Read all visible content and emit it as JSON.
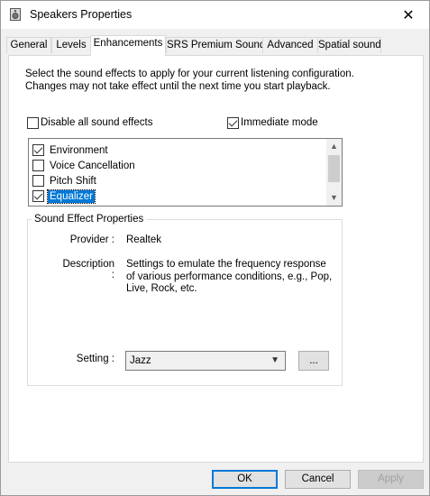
{
  "window": {
    "title": "Speakers Properties"
  },
  "tabs": [
    {
      "label": "General"
    },
    {
      "label": "Levels"
    },
    {
      "label": "Enhancements",
      "active": true
    },
    {
      "label": "SRS Premium Sound"
    },
    {
      "label": "Advanced"
    },
    {
      "label": "Spatial sound"
    }
  ],
  "enhancements": {
    "description": "Select the sound effects to apply for your current listening configuration. Changes may not take effect until the next time you start playback.",
    "disable_all": {
      "label": "Disable all sound effects",
      "checked": false
    },
    "immediate_mode": {
      "label": "Immediate mode",
      "checked": true
    },
    "effects": [
      {
        "label": "Environment",
        "checked": true,
        "selected": false
      },
      {
        "label": "Voice Cancellation",
        "checked": false,
        "selected": false
      },
      {
        "label": "Pitch Shift",
        "checked": false,
        "selected": false
      },
      {
        "label": "Equalizer",
        "checked": true,
        "selected": true
      }
    ],
    "properties": {
      "legend": "Sound Effect Properties",
      "provider_key": "Provider :",
      "provider_value": "Realtek",
      "description_key": "Description :",
      "description_value": "Settings to emulate the frequency response of various performance conditions,  e.g., Pop, Live, Rock, etc.",
      "setting_key": "Setting :",
      "setting_value": "Jazz",
      "more_button": "..."
    }
  },
  "buttons": {
    "ok": "OK",
    "cancel": "Cancel",
    "apply": "Apply"
  },
  "colors": {
    "accent": "#0078d7"
  }
}
